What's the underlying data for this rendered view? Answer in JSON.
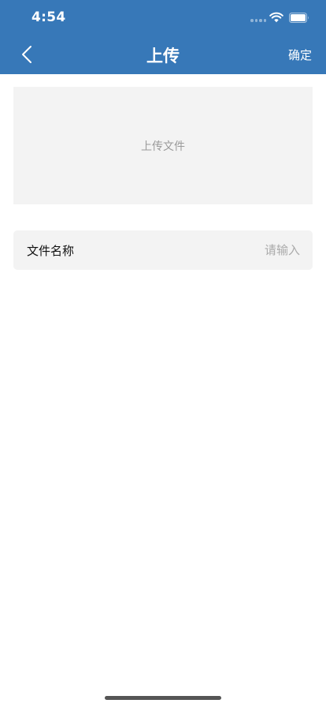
{
  "status_bar": {
    "time": "4:54"
  },
  "nav": {
    "title": "上传",
    "confirm_label": "确定",
    "back_icon": "chevron-left-icon"
  },
  "upload": {
    "label": "上传文件"
  },
  "form": {
    "file_name_label": "文件名称",
    "file_name_value": "",
    "file_name_placeholder": "请输入"
  },
  "colors": {
    "nav_background": "#3778b8",
    "field_background": "#f3f3f3"
  }
}
